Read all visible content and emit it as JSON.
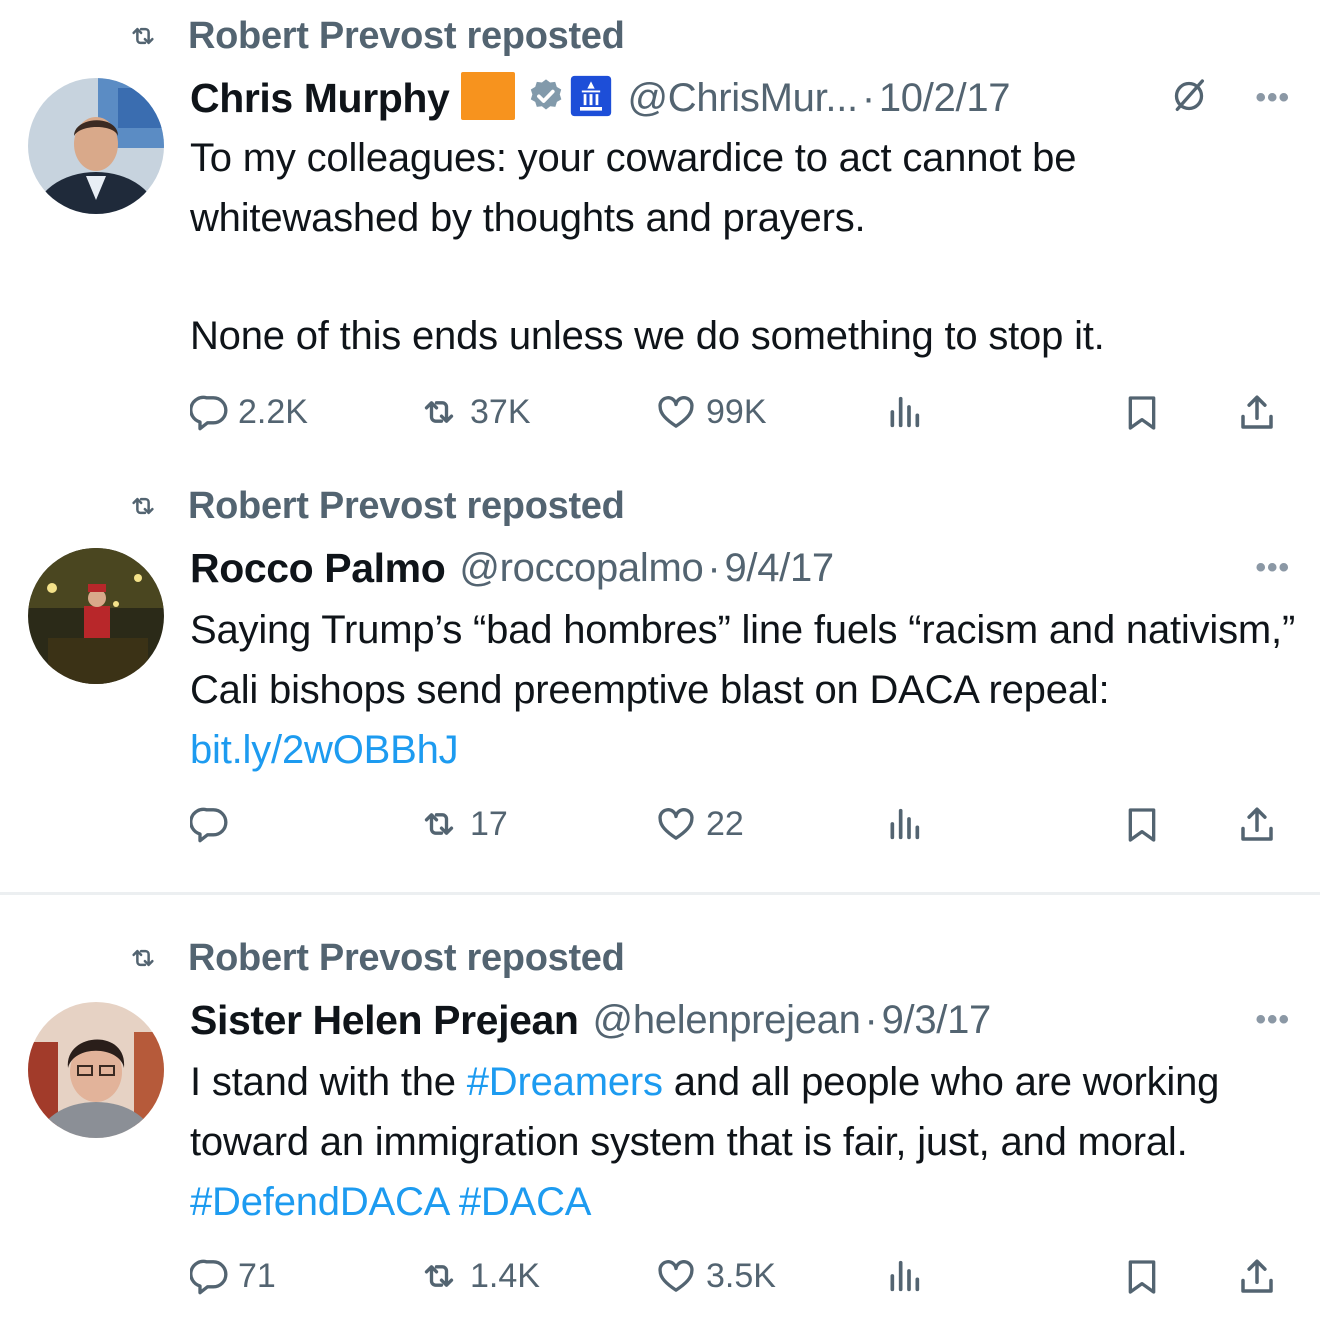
{
  "tweets": [
    {
      "social_context": "Robert Prevost reposted",
      "author_name": "Chris Murphy",
      "handle": "@ChrisMur...",
      "date": "10/2/17",
      "text_parts": [
        {
          "text": "To my colleagues: your cowardice to act cannot be whitewashed by thoughts and prayers."
        },
        {
          "text": "None of this ends unless we do something to stop it."
        }
      ],
      "metrics": {
        "replies": "2.2K",
        "reposts": "37K",
        "likes": "99K"
      }
    },
    {
      "social_context": "Robert Prevost reposted",
      "author_name": "Rocco Palmo",
      "handle": "@roccopalmo",
      "date": "9/4/17",
      "text": "Saying Trump’s “bad hombres” line fuels “racism and nativism,” Cali bishops send preemptive blast on DACA repeal: ",
      "link": "bit.ly/2wOBBhJ",
      "metrics": {
        "replies": "",
        "reposts": "17",
        "likes": "22"
      }
    },
    {
      "social_context": "Robert Prevost reposted",
      "author_name": "Sister Helen Prejean",
      "handle": "@helenprejean",
      "date": "9/3/17",
      "text_a": "I stand with the ",
      "hashtag_1": "#Dreamers",
      "text_b": " and all people who are working toward an immigration system that is fair, just, and moral. ",
      "hashtag_2": "#DefendDACA",
      "hashtag_3": "#DACA",
      "metrics": {
        "replies": "71",
        "reposts": "1.4K",
        "likes": "3.5K"
      }
    }
  ],
  "ui": {
    "dot_separator": "·",
    "more_label": "•••"
  },
  "colors": {
    "text_primary": "#0f1419",
    "text_secondary": "#536471",
    "link": "#1d9bf0",
    "verified": "#829aab",
    "badge_orange": "#f7931e",
    "gov_badge": "#1d4ed8"
  },
  "icons": {
    "social": "repost-icon",
    "reply": "reply-icon",
    "repost": "repost-icon",
    "like": "heart-icon",
    "views": "views-icon",
    "bookmark": "bookmark-icon",
    "share": "share-icon",
    "grok": "grok-icon",
    "verified": "verified-badge-icon",
    "government": "government-badge-icon",
    "affiliate": "orange-square-badge-icon"
  }
}
